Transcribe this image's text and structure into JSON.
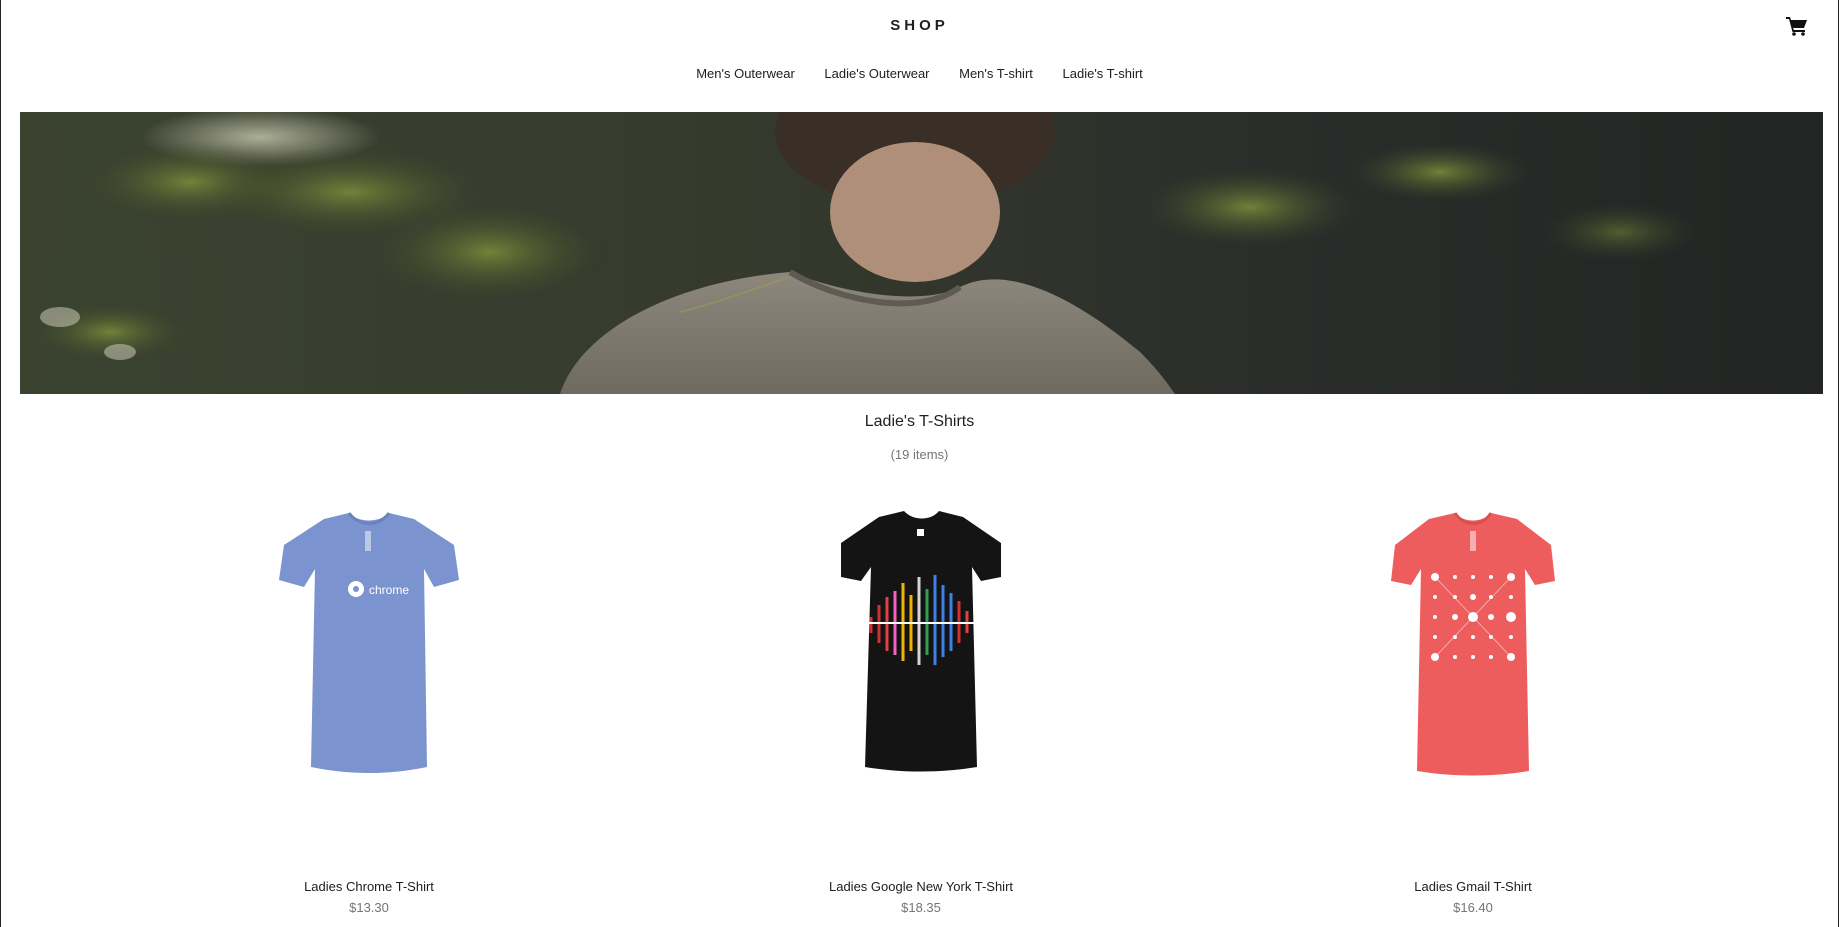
{
  "header": {
    "logo": "SHOP",
    "cart_icon": "shopping-cart-icon"
  },
  "nav": {
    "items": [
      {
        "label": "Men's Outerwear"
      },
      {
        "label": "Ladie's Outerwear"
      },
      {
        "label": "Men's T-shirt"
      },
      {
        "label": "Ladie's T-shirt"
      }
    ]
  },
  "category": {
    "title": "Ladie's T-Shirts",
    "count": "(19 items)"
  },
  "products": [
    {
      "name": "Ladies Chrome T-Shirt",
      "price": "$13.30",
      "color": "#7b93cf"
    },
    {
      "name": "Ladies Google New York T-Shirt",
      "price": "$18.35",
      "color": "#141414"
    },
    {
      "name": "Ladies Gmail T-Shirt",
      "price": "$16.40",
      "color": "#ee5d5d"
    }
  ],
  "colors": {
    "text": "#202020",
    "muted": "#757575"
  }
}
